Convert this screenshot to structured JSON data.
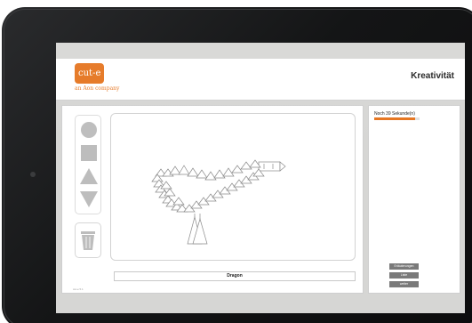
{
  "app": {
    "title": "Kreativität",
    "brand": {
      "logo_text": "cut-e",
      "tagline": "an Aon company"
    }
  },
  "timer": {
    "text": "Noch 39 Sekunde(n)",
    "remaining_fraction": 0.9,
    "bar_color": "#e5741e"
  },
  "tools": {
    "shapes": [
      "circle-icon",
      "square-icon",
      "triangle-up-icon",
      "triangle-down-icon"
    ],
    "trash": "trash-icon"
  },
  "drawing": {
    "name": "Dragon"
  },
  "footer": {
    "tiny_text": "cut-e 5.1"
  },
  "sidebar_buttons": [
    {
      "label": "Erläuterungen"
    },
    {
      "label": "Liste"
    },
    {
      "label": "weiter"
    }
  ],
  "colors": {
    "accent": "#e5741e",
    "shape_fill": "#bdbdbd",
    "button": "#7a7a7a"
  }
}
